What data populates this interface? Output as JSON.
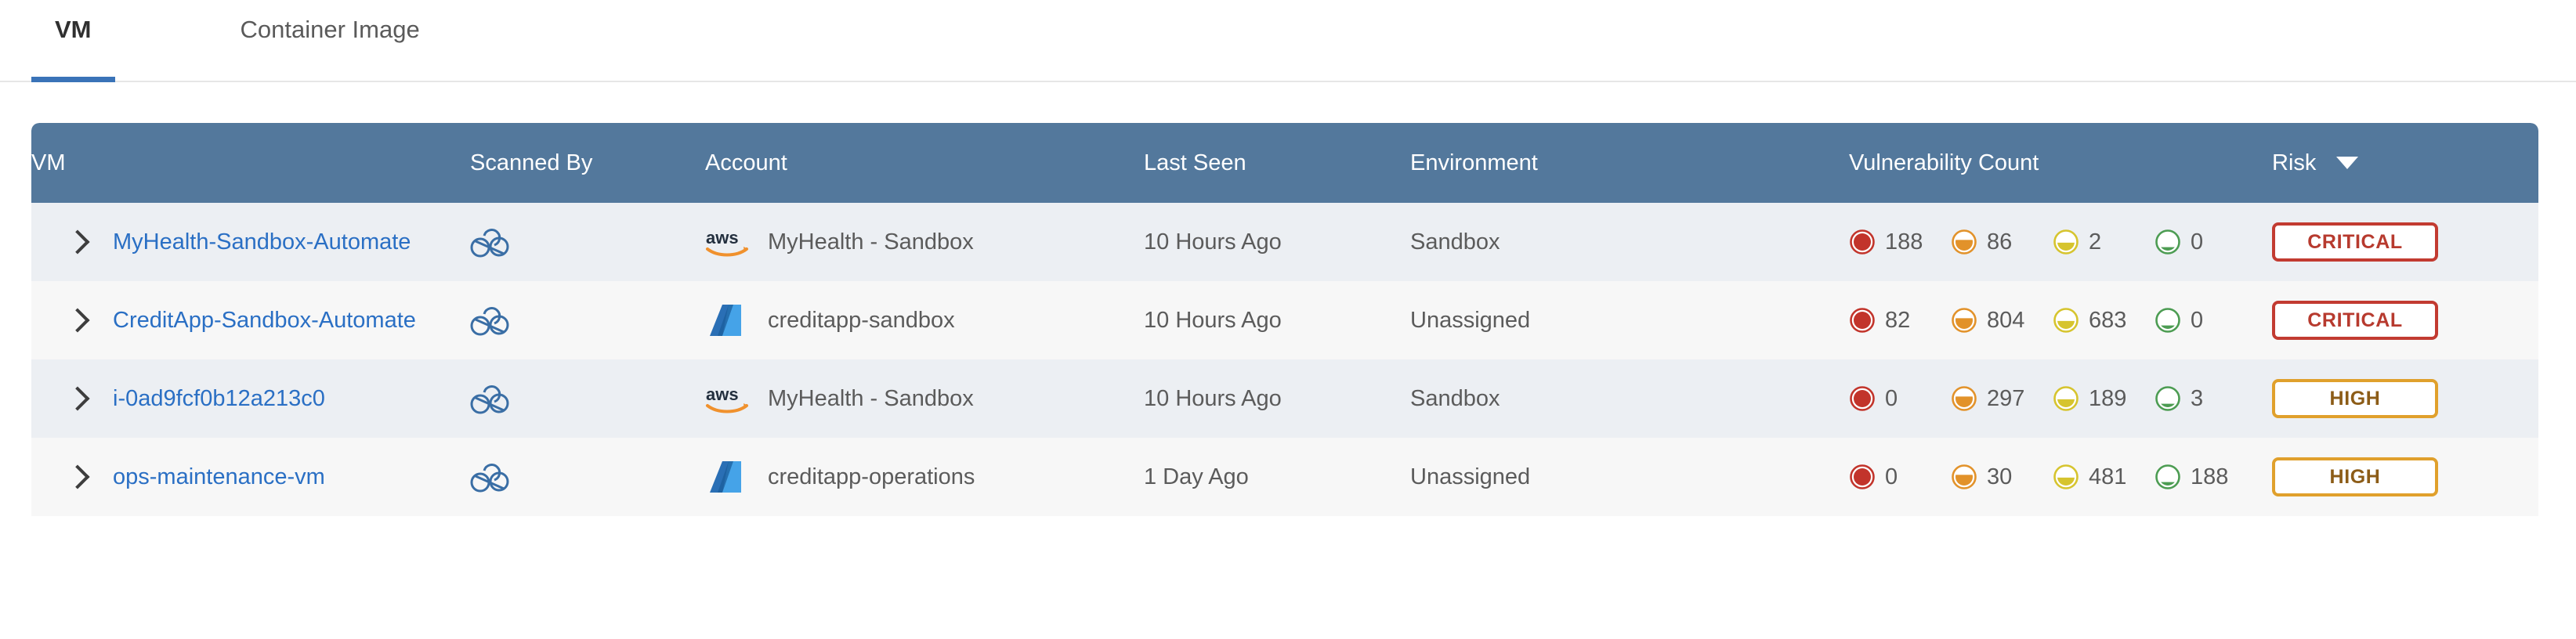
{
  "tabs": [
    {
      "label": "VM",
      "active": true
    },
    {
      "label": "Container Image",
      "active": false
    }
  ],
  "table": {
    "columns": {
      "vm": "VM",
      "scanned_by": "Scanned By",
      "account": "Account",
      "last_seen": "Last Seen",
      "environment": "Environment",
      "vulnerability_count": "Vulnerability Count",
      "risk": "Risk"
    },
    "sort": {
      "column": "Risk",
      "direction": "desc",
      "icon": "chevron-down-icon"
    },
    "colors": {
      "header_bg": "#53789c",
      "row_odd_bg": "#eceff3",
      "row_even_bg": "#f7f7f7",
      "link": "#2a6fc4",
      "tab_accent": "#3a73b8",
      "critical": "#c23b31",
      "high": "#e0a02c",
      "medium": "#d8c23c",
      "low": "#4c9c52"
    },
    "rows": [
      {
        "expand_icon": "chevron-right-icon",
        "vm": "MyHealth-Sandbox-Automate",
        "scanned_by_icon": "cloud-scanner-icon",
        "account_icon": "aws-logo-icon",
        "account": "MyHealth - Sandbox",
        "last_seen": "10 Hours Ago",
        "environment": "Sandbox",
        "vulns": {
          "critical": "188",
          "high": "86",
          "medium": "2",
          "low": "0"
        },
        "risk": "CRITICAL",
        "risk_level": "critical"
      },
      {
        "expand_icon": "chevron-right-icon",
        "vm": "CreditApp-Sandbox-Automate",
        "scanned_by_icon": "cloud-scanner-icon",
        "account_icon": "azure-logo-icon",
        "account": "creditapp-sandbox",
        "last_seen": "10 Hours Ago",
        "environment": "Unassigned",
        "vulns": {
          "critical": "82",
          "high": "804",
          "medium": "683",
          "low": "0"
        },
        "risk": "CRITICAL",
        "risk_level": "critical"
      },
      {
        "expand_icon": "chevron-right-icon",
        "vm": "i-0ad9fcf0b12a213c0",
        "scanned_by_icon": "cloud-scanner-icon",
        "account_icon": "aws-logo-icon",
        "account": "MyHealth - Sandbox",
        "last_seen": "10 Hours Ago",
        "environment": "Sandbox",
        "vulns": {
          "critical": "0",
          "high": "297",
          "medium": "189",
          "low": "3"
        },
        "risk": "HIGH",
        "risk_level": "high"
      },
      {
        "expand_icon": "chevron-right-icon",
        "vm": "ops-maintenance-vm",
        "scanned_by_icon": "cloud-scanner-icon",
        "account_icon": "azure-logo-icon",
        "account": "creditapp-operations",
        "last_seen": "1 Day Ago",
        "environment": "Unassigned",
        "vulns": {
          "critical": "0",
          "high": "30",
          "medium": "481",
          "low": "188"
        },
        "risk": "HIGH",
        "risk_level": "high"
      }
    ]
  }
}
